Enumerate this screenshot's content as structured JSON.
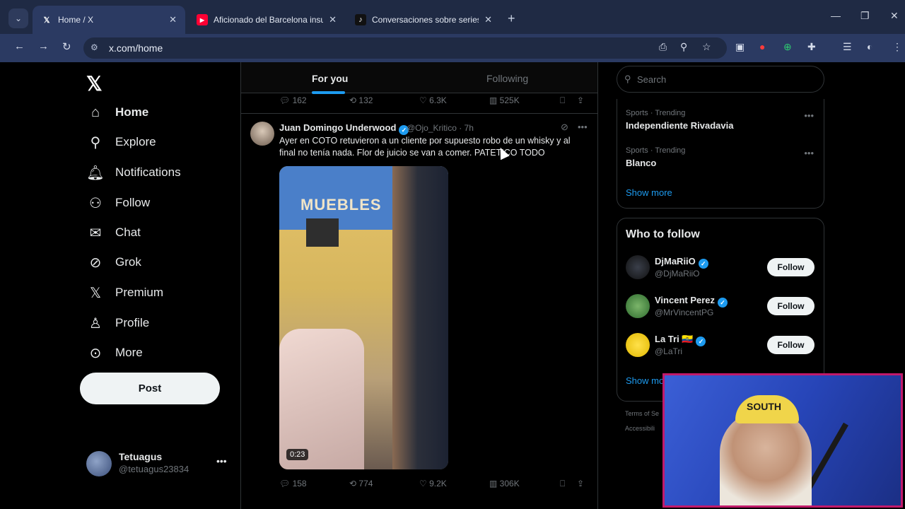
{
  "browser": {
    "tabs": [
      {
        "label": "Home / X",
        "icon": "x-logo-icon",
        "active": true
      },
      {
        "label": "Aficionado del Barcelona insult",
        "icon": "youtube-icon",
        "active": false
      },
      {
        "label": "Conversaciones sobre series y m",
        "icon": "tiktok-icon",
        "active": false
      }
    ],
    "url": "x.com/home",
    "accent": "#2b3a62"
  },
  "nav": {
    "items": [
      {
        "label": "Home",
        "icon": "home-icon"
      },
      {
        "label": "Explore",
        "icon": "search-icon"
      },
      {
        "label": "Notifications",
        "icon": "bell-icon"
      },
      {
        "label": "Follow",
        "icon": "person-add-icon"
      },
      {
        "label": "Chat",
        "icon": "mail-icon"
      },
      {
        "label": "Grok",
        "icon": "grok-icon"
      },
      {
        "label": "Premium",
        "icon": "x-logo-icon"
      },
      {
        "label": "Profile",
        "icon": "person-icon"
      },
      {
        "label": "More",
        "icon": "more-circle-icon"
      }
    ],
    "post_label": "Post",
    "account": {
      "name": "Tetuagus",
      "handle": "@tetuagus23834"
    }
  },
  "timeline": {
    "tabs": {
      "for_you": "For you",
      "following": "Following"
    },
    "prev_tweet_stats": {
      "replies": "162",
      "reposts": "132",
      "likes": "6.3K",
      "views": "525K"
    },
    "tweet": {
      "author": "Juan Domingo Underwood",
      "handle": "@Ojo_Kritico",
      "time": "· 7h",
      "text": "Ayer en COTO retuvieron a un cliente por supuesto robo de un whisky y al final no tenía nada. Flor de juicio se van a comer. PATETICO TODO",
      "media_sign": "MUEBLES",
      "video_duration": "0:23",
      "stats": {
        "replies": "158",
        "reposts": "774",
        "likes": "9.2K",
        "views": "306K"
      }
    }
  },
  "sidebar": {
    "search_placeholder": "Search",
    "trends": [
      {
        "category": "Sports · Trending",
        "name": "Independiente Rivadavia"
      },
      {
        "category": "Sports · Trending",
        "name": "Blanco"
      }
    ],
    "show_more": "Show more",
    "who_to_follow_title": "Who to follow",
    "who_to_follow": [
      {
        "name": "DjMaRiiO",
        "handle": "@DjMaRiiO",
        "button": "Follow"
      },
      {
        "name": "Vincent Perez",
        "handle": "@MrVincentPG",
        "button": "Follow"
      },
      {
        "name": "La Tri 🇪🇨",
        "handle": "@LaTri",
        "button": "Follow"
      }
    ],
    "show_more_2": "Show mo",
    "footer": [
      "Terms of Se",
      "Accessibili"
    ]
  },
  "webcam": {
    "cap_text": "SOUTH",
    "border_color": "#c11a6b"
  }
}
